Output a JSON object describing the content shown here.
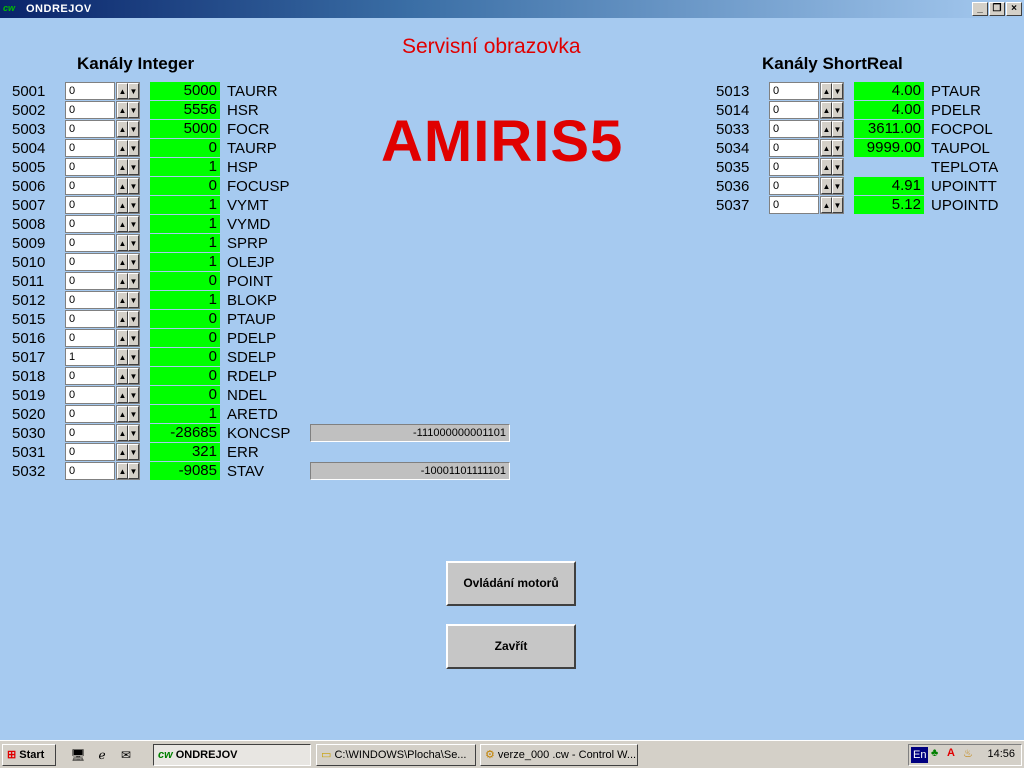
{
  "window": {
    "title": "ONDREJOV",
    "app_icon": "cw"
  },
  "screen_title": "Servisní obrazovka",
  "logo_text": "AMIRIS5",
  "integer": {
    "header": "Kanály Integer",
    "rows": [
      {
        "ch": "5001",
        "input": "0",
        "value": "5000",
        "name": "TAURR"
      },
      {
        "ch": "5002",
        "input": "0",
        "value": "5556",
        "name": "HSR"
      },
      {
        "ch": "5003",
        "input": "0",
        "value": "5000",
        "name": "FOCR"
      },
      {
        "ch": "5004",
        "input": "0",
        "value": "0",
        "name": "TAURP"
      },
      {
        "ch": "5005",
        "input": "0",
        "value": "1",
        "name": "HSP"
      },
      {
        "ch": "5006",
        "input": "0",
        "value": "0",
        "name": "FOCUSP"
      },
      {
        "ch": "5007",
        "input": "0",
        "value": "1",
        "name": "VYMT"
      },
      {
        "ch": "5008",
        "input": "0",
        "value": "1",
        "name": "VYMD"
      },
      {
        "ch": "5009",
        "input": "0",
        "value": "1",
        "name": "SPRP"
      },
      {
        "ch": "5010",
        "input": "0",
        "value": "1",
        "name": "OLEJP"
      },
      {
        "ch": "5011",
        "input": "0",
        "value": "0",
        "name": "POINT"
      },
      {
        "ch": "5012",
        "input": "0",
        "value": "1",
        "name": "BLOKP"
      },
      {
        "ch": "5015",
        "input": "0",
        "value": "0",
        "name": "PTAUP"
      },
      {
        "ch": "5016",
        "input": "0",
        "value": "0",
        "name": "PDELP"
      },
      {
        "ch": "5017",
        "input": "1",
        "value": "0",
        "name": "SDELP"
      },
      {
        "ch": "5018",
        "input": "0",
        "value": "0",
        "name": "RDELP"
      },
      {
        "ch": "5019",
        "input": "0",
        "value": "0",
        "name": "NDEL"
      },
      {
        "ch": "5020",
        "input": "0",
        "value": "1",
        "name": "ARETD"
      },
      {
        "ch": "5030",
        "input": "0",
        "value": "-28685",
        "name": "KONCSP",
        "binary": "-111000000001101"
      },
      {
        "ch": "5031",
        "input": "0",
        "value": "321",
        "name": "ERR"
      },
      {
        "ch": "5032",
        "input": "0",
        "value": "-9085",
        "name": "STAV",
        "binary": "-10001101111101"
      }
    ]
  },
  "shortreal": {
    "header": "Kanály ShortReal",
    "rows": [
      {
        "ch": "5013",
        "input": "0",
        "value": "4.00",
        "name": "PTAUR"
      },
      {
        "ch": "5014",
        "input": "0",
        "value": "4.00",
        "name": "PDELR"
      },
      {
        "ch": "5033",
        "input": "0",
        "value": "3611.00",
        "name": "FOCPOL"
      },
      {
        "ch": "5034",
        "input": "0",
        "value": "9999.00",
        "name": "TAUPOL"
      },
      {
        "ch": "5035",
        "input": "0",
        "value": "",
        "name": "TEPLOTA"
      },
      {
        "ch": "5036",
        "input": "0",
        "value": "4.91",
        "name": "UPOINTT"
      },
      {
        "ch": "5037",
        "input": "0",
        "value": "5.12",
        "name": "UPOINTD"
      }
    ]
  },
  "buttons": {
    "motors": "Ovládání motorů",
    "close": "Zavřít"
  },
  "taskbar": {
    "start": "Start",
    "tasks": [
      "ONDREJOV",
      "C:\\WINDOWS\\Plocha\\Se...",
      "verze_000 .cw - Control W..."
    ],
    "lang": "En",
    "clock": "14:56"
  },
  "colors": {
    "background": "#a6caf0",
    "value_green": "#00ff00",
    "accent_red": "#e00000"
  }
}
